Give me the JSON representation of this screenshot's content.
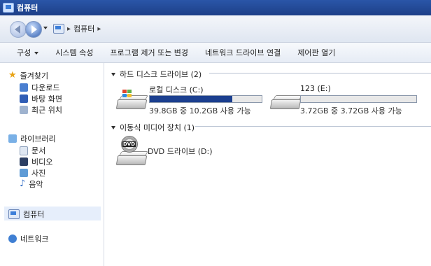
{
  "window": {
    "title": "컴퓨터"
  },
  "address": {
    "location": "컴퓨터"
  },
  "toolbar": {
    "items": [
      "구성",
      "시스템 속성",
      "프로그램 제거 또는 변경",
      "네트워크 드라이브 연결",
      "제어판 열기"
    ]
  },
  "nav": {
    "favorites": {
      "label": "즐겨찾기",
      "items": [
        "다운로드",
        "바탕 화면",
        "최근 위치"
      ]
    },
    "libraries": {
      "label": "라이브러리",
      "items": [
        "문서",
        "비디오",
        "사진",
        "음악"
      ]
    },
    "computer": "컴퓨터",
    "network": "네트워크"
  },
  "main": {
    "hdd_group": {
      "label": "하드 디스크 드라이브 (2)"
    },
    "drives": [
      {
        "name": "로컬 디스크 (C:)",
        "space": "39.8GB 중 10.2GB 사용 가능",
        "used_fraction": 0.74
      },
      {
        "name": "123 (E:)",
        "space": "3.72GB 중 3.72GB 사용 가능",
        "used_fraction": 0.0
      }
    ],
    "removable_group": {
      "label": "이동식 미디어 장치 (1)"
    },
    "dvd": {
      "name": "DVD 드라이브 (D:)"
    }
  },
  "colors": {
    "titlebar": "#2a56a8",
    "usage_bar": "#1b3f8f"
  }
}
